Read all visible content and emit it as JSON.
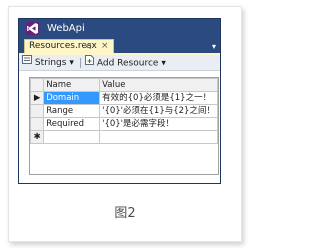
{
  "window": {
    "title": "WebApi"
  },
  "tabs": [
    {
      "label": "Resources.resx",
      "pin": "⊲",
      "close": "×"
    }
  ],
  "tab_dropdown": "▾",
  "toolbar": {
    "strings_label": "Strings",
    "strings_dropdown": "▾",
    "add_resource_label": "Add Resource",
    "add_resource_dropdown": "▾"
  },
  "grid": {
    "columns": [
      "Name",
      "Value"
    ],
    "rows": [
      {
        "marker": "▶",
        "name": "Domain",
        "value": "有效的{0}必须是{1}之一！"
      },
      {
        "marker": "",
        "name": "Range",
        "value": "'{0}'必须在{1}与{2}之间！"
      },
      {
        "marker": "",
        "name": "Required",
        "value": "'{0}'是必需字段！"
      },
      {
        "marker": "✱",
        "name": "",
        "value": ""
      }
    ]
  },
  "caption": "图2",
  "colors": {
    "window_chrome": "#2b4a80",
    "active_tab": "#fff6c8",
    "selection": "#3399ff",
    "vs_logo": "#68217a"
  },
  "icons": [
    "visual-studio-logo-icon",
    "pin-icon",
    "close-icon",
    "strings-icon",
    "add-resource-icon"
  ]
}
